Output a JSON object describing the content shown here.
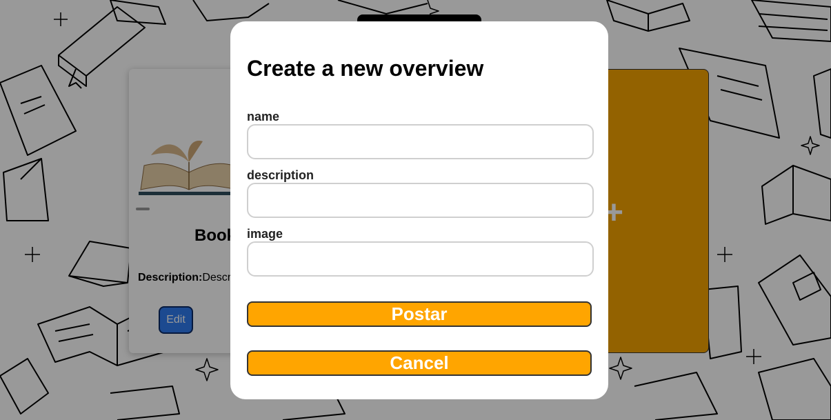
{
  "page": {
    "card": {
      "title": "Book",
      "description_label": "Description:",
      "description_value": "Descr",
      "edit_label": "Edit"
    },
    "add_card": {
      "icon": "plus-icon",
      "symbol": "+"
    }
  },
  "modal": {
    "title": "Create a new overview",
    "fields": [
      {
        "label": "name",
        "value": "",
        "placeholder": ""
      },
      {
        "label": "description",
        "value": "",
        "placeholder": ""
      },
      {
        "label": "image",
        "value": "",
        "placeholder": ""
      }
    ],
    "submit_label": "Postar",
    "cancel_label": "Cancel"
  },
  "colors": {
    "accent": "#ffa500",
    "edit_button": "#2f7cf0",
    "overlay": "rgba(0,0,0,0.4)"
  }
}
